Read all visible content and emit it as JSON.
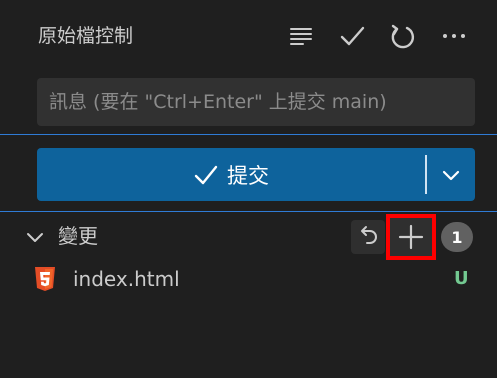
{
  "header": {
    "title": "原始檔控制",
    "icons": [
      "list-icon",
      "check-icon",
      "refresh-icon",
      "more-icon"
    ]
  },
  "commit_message": {
    "placeholder": "訊息 (要在 \"Ctrl+Enter\" 上提交 main)",
    "value": ""
  },
  "commit_button": {
    "label": "提交"
  },
  "changes_section": {
    "label": "變更",
    "count": "1",
    "actions": [
      "discard-icon",
      "plus-icon"
    ]
  },
  "files": [
    {
      "name": "index.html",
      "status": "U",
      "icon": "html5-icon"
    }
  ],
  "colors": {
    "background": "#1f1f1f",
    "input_background": "#313131",
    "focus_line": "#2f7bd5",
    "commit_button": "#0e639c",
    "badge": "#616161",
    "untracked_status": "#73c991",
    "html_icon": "#e44d26",
    "highlight_box": "#ff0000"
  }
}
